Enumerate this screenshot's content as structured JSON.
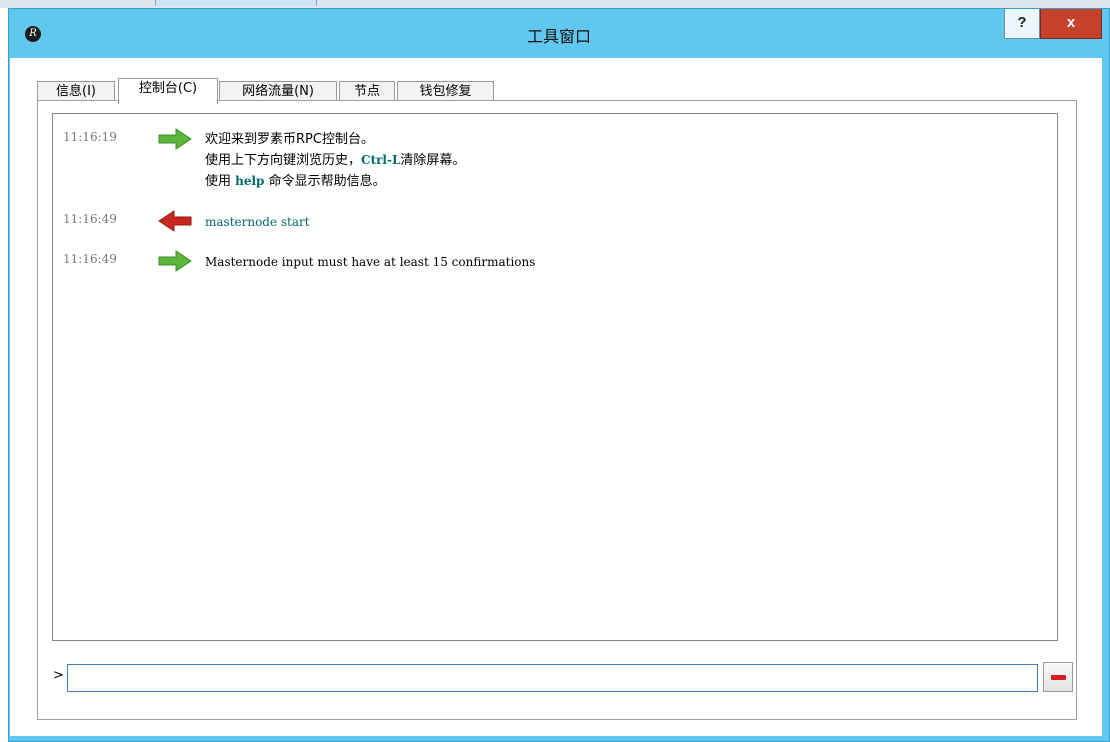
{
  "window": {
    "title": "工具窗口",
    "help_label": "?",
    "close_label": "x"
  },
  "tabs": [
    {
      "label": "信息(I)"
    },
    {
      "label": "控制台(C)"
    },
    {
      "label": "网络流量(N)"
    },
    {
      "label": "节点"
    },
    {
      "label": "钱包修复"
    }
  ],
  "console": {
    "messages": [
      {
        "time": "11:16:19",
        "direction": "reply",
        "line1": "欢迎来到罗素币RPC控制台。",
        "line2_a": "使用上下方向键浏览历史，",
        "line2_kw": "Ctrl-L",
        "line2_b": "清除屏幕。",
        "line3_a": "使用 ",
        "line3_kw": "help",
        "line3_b": " 命令显示帮助信息。"
      },
      {
        "time": "11:16:49",
        "direction": "request",
        "text": "masternode start"
      },
      {
        "time": "11:16:49",
        "direction": "reply",
        "text": "Masternode input must have at least 15 confirmations"
      }
    ],
    "prompt": ">",
    "input_value": ""
  },
  "colors": {
    "titlebar": "#60c8ee",
    "close": "#c7402b",
    "reply_arrow": "#5cb53a",
    "request_arrow": "#c8281e",
    "command_text": "#006a6a"
  }
}
